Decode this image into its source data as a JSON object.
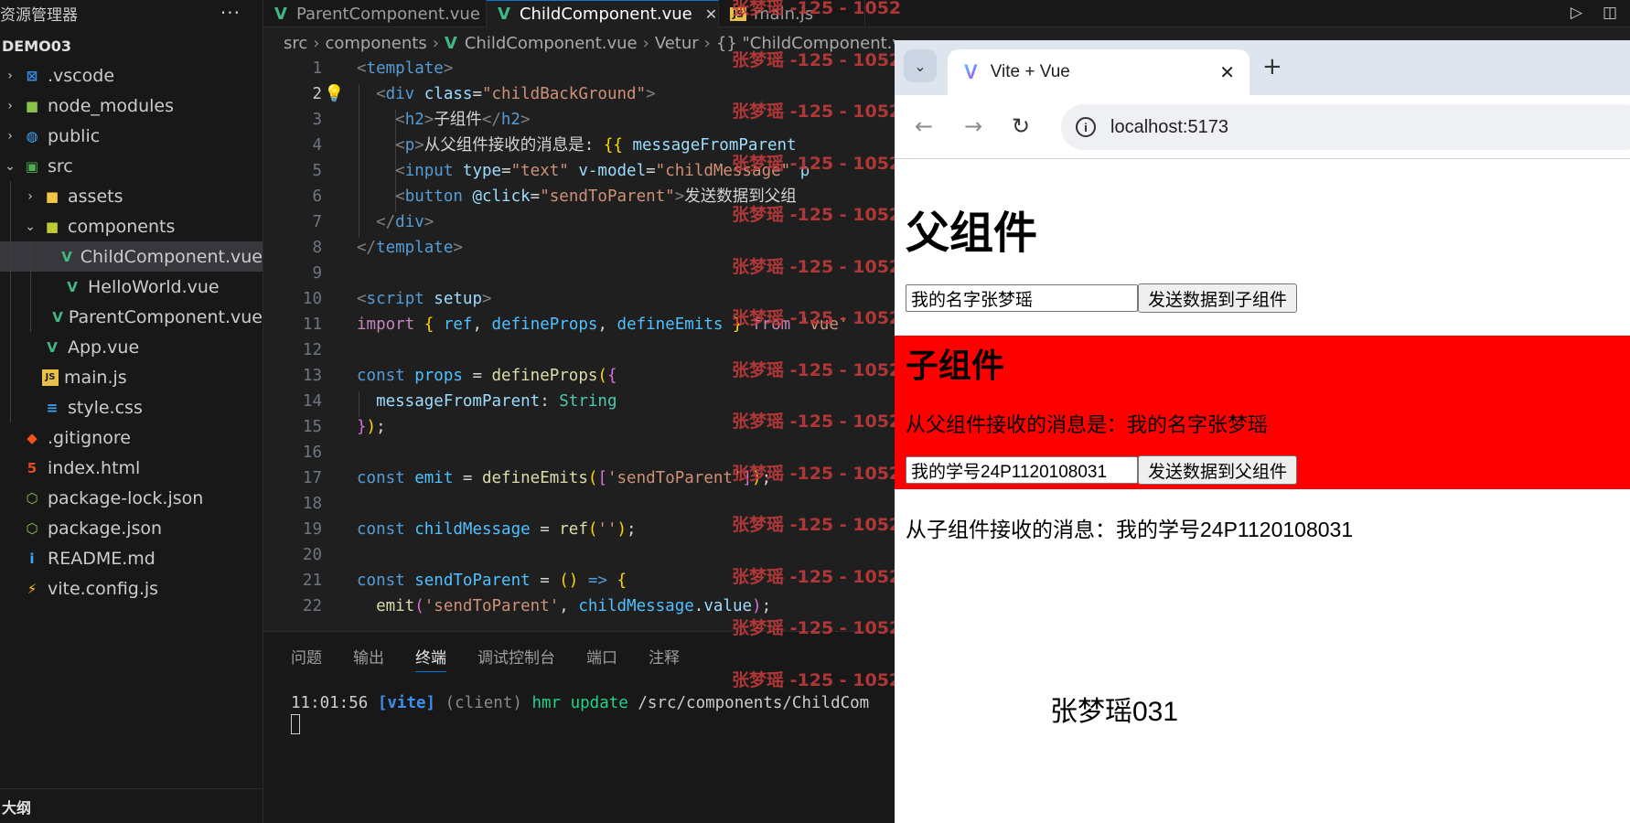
{
  "sidebar": {
    "header": "资源管理器",
    "more": "···",
    "project": "DEMO03",
    "items": [
      {
        "label": ".vscode",
        "icon": "vscode-folder-icon",
        "glyph": "⊠",
        "color": "#3a8ee6"
      },
      {
        "label": "node_modules",
        "icon": "node-folder-icon",
        "glyph": "■",
        "color": "#8bc34a"
      },
      {
        "label": "public",
        "icon": "globe-folder-icon",
        "glyph": "◍",
        "color": "#42a5f5"
      },
      {
        "label": "src",
        "icon": "src-folder-icon",
        "glyph": "▣",
        "color": "#4caf50"
      },
      {
        "label": "assets",
        "icon": "folder-icon",
        "glyph": "■",
        "color": "#f4c542"
      },
      {
        "label": "components",
        "icon": "components-folder-icon",
        "glyph": "■",
        "color": "#c0ca33"
      },
      {
        "label": "ChildComponent.vue",
        "icon": "vue-file-icon",
        "glyph": "V",
        "color": "#41b883"
      },
      {
        "label": "HelloWorld.vue",
        "icon": "vue-file-icon",
        "glyph": "V",
        "color": "#41b883"
      },
      {
        "label": "ParentComponent.vue",
        "icon": "vue-file-icon",
        "glyph": "V",
        "color": "#41b883"
      },
      {
        "label": "App.vue",
        "icon": "vue-file-icon",
        "glyph": "V",
        "color": "#41b883"
      },
      {
        "label": "main.js",
        "icon": "js-file-icon",
        "glyph": "JS",
        "color": "#e8c04a"
      },
      {
        "label": "style.css",
        "icon": "css-file-icon",
        "glyph": "≡",
        "color": "#42a5f5"
      },
      {
        "label": ".gitignore",
        "icon": "git-icon",
        "glyph": "◆",
        "color": "#f4511e"
      },
      {
        "label": "index.html",
        "icon": "html-file-icon",
        "glyph": "5",
        "color": "#e44d26"
      },
      {
        "label": "package-lock.json",
        "icon": "nodejs-icon",
        "glyph": "⬡",
        "color": "#8bc34a"
      },
      {
        "label": "package.json",
        "icon": "nodejs-icon",
        "glyph": "⬡",
        "color": "#8bc34a"
      },
      {
        "label": "README.md",
        "icon": "info-icon",
        "glyph": "i",
        "color": "#42a5f5"
      },
      {
        "label": "vite.config.js",
        "icon": "vite-bolt-icon",
        "glyph": "⚡",
        "color": "#ffc107"
      }
    ],
    "outline": "大纲"
  },
  "tabs": [
    {
      "label": "ParentComponent.vue"
    },
    {
      "label": "ChildComponent.vue",
      "close": "✕"
    },
    {
      "label": "main.js",
      "badge": "JS"
    }
  ],
  "breadcrumb": {
    "parts": [
      "src",
      "components",
      "ChildComponent.vue",
      "Vetur",
      "{} \"ChildComponent.vue\""
    ]
  },
  "code": {
    "current_line": 2,
    "lines": [
      {
        "n": "1",
        "tokens": [
          [
            "t-pun",
            "<"
          ],
          [
            "t-tag",
            "template"
          ],
          [
            "t-pun",
            ">"
          ]
        ]
      },
      {
        "n": "2",
        "tokens": [
          [
            "t-pun",
            "  <"
          ],
          [
            "t-tag",
            "div"
          ],
          [
            "t-attr",
            " class"
          ],
          [
            "t-txt",
            "="
          ],
          [
            "t-str",
            "\"childBackGround\""
          ],
          [
            "t-pun",
            ">"
          ]
        ]
      },
      {
        "n": "3",
        "tokens": [
          [
            "t-pun",
            "    <"
          ],
          [
            "t-tag",
            "h2"
          ],
          [
            "t-pun",
            ">"
          ],
          [
            "t-txt",
            "子组件"
          ],
          [
            "t-pun",
            "</"
          ],
          [
            "t-tag",
            "h2"
          ],
          [
            "t-pun",
            ">"
          ]
        ]
      },
      {
        "n": "4",
        "tokens": [
          [
            "t-pun",
            "    <"
          ],
          [
            "t-tag",
            "p"
          ],
          [
            "t-pun",
            ">"
          ],
          [
            "t-txt",
            "从父组件接收的消息是: "
          ],
          [
            "t-brace",
            "{{"
          ],
          [
            "t-attr",
            " messageFromParent"
          ]
        ]
      },
      {
        "n": "5",
        "tokens": [
          [
            "t-pun",
            "    <"
          ],
          [
            "t-tag",
            "input"
          ],
          [
            "t-attr",
            " type"
          ],
          [
            "t-txt",
            "="
          ],
          [
            "t-str",
            "\"text\""
          ],
          [
            "t-attr",
            " v-model"
          ],
          [
            "t-txt",
            "="
          ],
          [
            "t-str",
            "\"childMessage\""
          ],
          [
            "t-attr",
            " p"
          ]
        ]
      },
      {
        "n": "6",
        "tokens": [
          [
            "t-pun",
            "    <"
          ],
          [
            "t-tag",
            "button"
          ],
          [
            "t-attr",
            " @click"
          ],
          [
            "t-txt",
            "="
          ],
          [
            "t-str",
            "\"sendToParent\""
          ],
          [
            "t-pun",
            ">"
          ],
          [
            "t-txt",
            "发送数据到父组"
          ]
        ]
      },
      {
        "n": "7",
        "tokens": [
          [
            "t-pun",
            "  </"
          ],
          [
            "t-tag",
            "div"
          ],
          [
            "t-pun",
            ">"
          ]
        ]
      },
      {
        "n": "8",
        "tokens": [
          [
            "t-pun",
            "</"
          ],
          [
            "t-tag",
            "template"
          ],
          [
            "t-pun",
            ">"
          ]
        ]
      },
      {
        "n": "9",
        "tokens": []
      },
      {
        "n": "10",
        "tokens": [
          [
            "t-pun",
            "<"
          ],
          [
            "t-tag",
            "script"
          ],
          [
            "t-attr",
            " setup"
          ],
          [
            "t-pun",
            ">"
          ]
        ]
      },
      {
        "n": "11",
        "tokens": [
          [
            "t-imp",
            "import"
          ],
          [
            "t-txt",
            " "
          ],
          [
            "t-brace",
            "{"
          ],
          [
            "t-var",
            " ref"
          ],
          [
            "t-txt",
            ","
          ],
          [
            "t-var",
            " defineProps"
          ],
          [
            "t-txt",
            ","
          ],
          [
            "t-var",
            " defineEmits"
          ],
          [
            "t-brace",
            " }"
          ],
          [
            "t-imp",
            " from"
          ],
          [
            "t-str",
            " 'vue'"
          ]
        ]
      },
      {
        "n": "12",
        "tokens": []
      },
      {
        "n": "13",
        "tokens": [
          [
            "t-kw",
            "const"
          ],
          [
            "t-var",
            " props"
          ],
          [
            "t-txt",
            " = "
          ],
          [
            "t-fn",
            "defineProps"
          ],
          [
            "t-brace",
            "("
          ],
          [
            "t-brace2",
            "{"
          ]
        ]
      },
      {
        "n": "14",
        "tokens": [
          [
            "t-prop",
            "  messageFromParent"
          ],
          [
            "t-txt",
            ": "
          ],
          [
            "t-type",
            "String"
          ]
        ]
      },
      {
        "n": "15",
        "tokens": [
          [
            "t-brace2",
            "}"
          ],
          [
            "t-brace",
            ")"
          ],
          [
            "t-txt",
            ";"
          ]
        ]
      },
      {
        "n": "16",
        "tokens": []
      },
      {
        "n": "17",
        "tokens": [
          [
            "t-kw",
            "const"
          ],
          [
            "t-var",
            " emit"
          ],
          [
            "t-txt",
            " = "
          ],
          [
            "t-fn",
            "defineEmits"
          ],
          [
            "t-brace",
            "("
          ],
          [
            "t-brace2",
            "["
          ],
          [
            "t-str",
            "'sendToParent'"
          ],
          [
            "t-brace2",
            "]"
          ],
          [
            "t-brace",
            ")"
          ],
          [
            "t-txt",
            ";"
          ]
        ]
      },
      {
        "n": "18",
        "tokens": []
      },
      {
        "n": "19",
        "tokens": [
          [
            "t-kw",
            "const"
          ],
          [
            "t-var",
            " childMessage"
          ],
          [
            "t-txt",
            " = "
          ],
          [
            "t-fn",
            "ref"
          ],
          [
            "t-brace",
            "("
          ],
          [
            "t-str",
            "''"
          ],
          [
            "t-brace",
            ")"
          ],
          [
            "t-txt",
            ";"
          ]
        ]
      },
      {
        "n": "20",
        "tokens": []
      },
      {
        "n": "21",
        "tokens": [
          [
            "t-kw",
            "const"
          ],
          [
            "t-var",
            " sendToParent"
          ],
          [
            "t-txt",
            " = "
          ],
          [
            "t-brace",
            "()"
          ],
          [
            "t-kw",
            " =>"
          ],
          [
            "t-brace",
            " {"
          ]
        ]
      },
      {
        "n": "22",
        "tokens": [
          [
            "t-fn",
            "  emit"
          ],
          [
            "t-brace2",
            "("
          ],
          [
            "t-str",
            "'sendToParent'"
          ],
          [
            "t-txt",
            ", "
          ],
          [
            "t-var",
            "childMessage"
          ],
          [
            "t-txt",
            "."
          ],
          [
            "t-prop",
            "value"
          ],
          [
            "t-brace2",
            ")"
          ],
          [
            "t-txt",
            ";"
          ]
        ]
      }
    ]
  },
  "panel": {
    "tabs": [
      "问题",
      "输出",
      "终端",
      "调试控制台",
      "端口",
      "注释"
    ],
    "active_tab": "终端",
    "terminal": {
      "time": "11:01:56",
      "tag": "[vite]",
      "client": "(client)",
      "hmr": "hmr update",
      "path": "/src/components/ChildCom"
    }
  },
  "watermark": "张梦瑶 -125 - 1052",
  "browser": {
    "tab_title": "Vite + Vue",
    "tab_logo": "V",
    "close": "✕",
    "new_tab": "+",
    "menu": "⌄",
    "back": "←",
    "forward": "→",
    "reload": "↻",
    "url": "localhost:5173",
    "info": "i"
  },
  "page": {
    "title": "父组件",
    "parent_input_value": "我的名字张梦瑶",
    "parent_button": "发送数据到子组件",
    "child_title": "子组件",
    "child_message": "从父组件接收的消息是：我的名字张梦瑶",
    "child_input_value": "我的学号24P1120108031",
    "child_button": "发送数据到父组件",
    "from_child": "从子组件接收的消息：我的学号24P1120108031",
    "signature": "张梦瑶031",
    "child_bg_color": "#ff0000"
  }
}
